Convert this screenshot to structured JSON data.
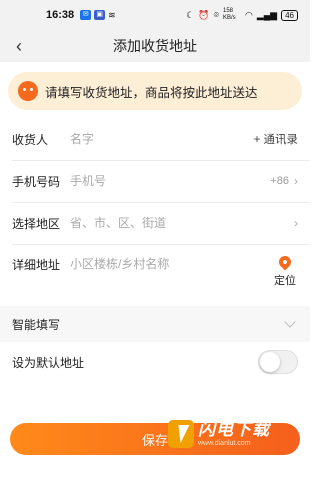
{
  "status_bar": {
    "time": "16:38",
    "speed": "158 KB/s",
    "battery": "46"
  },
  "nav": {
    "title": "添加收货地址"
  },
  "notice": {
    "text": "请填写收货地址，商品将按此地址送达"
  },
  "form": {
    "receiver": {
      "label": "收货人",
      "placeholder": "名字",
      "action": "+ 通讯录"
    },
    "phone": {
      "label": "手机号码",
      "placeholder": "手机号",
      "prefix": "+86"
    },
    "region": {
      "label": "选择地区",
      "placeholder": "省、市、区、街道"
    },
    "detail": {
      "label": "详细地址",
      "placeholder": "小区楼栋/乡村名称",
      "locate_label": "定位"
    }
  },
  "smart_fill": {
    "label": "智能填写"
  },
  "default_address": {
    "label": "设为默认地址",
    "enabled": false
  },
  "save_button": {
    "label": "保存"
  },
  "watermark": {
    "title": "闪电下载",
    "url": "www.dianlut.com"
  },
  "colors": {
    "accent": "#f56a1c",
    "notice_bg": "#fdeed6"
  }
}
